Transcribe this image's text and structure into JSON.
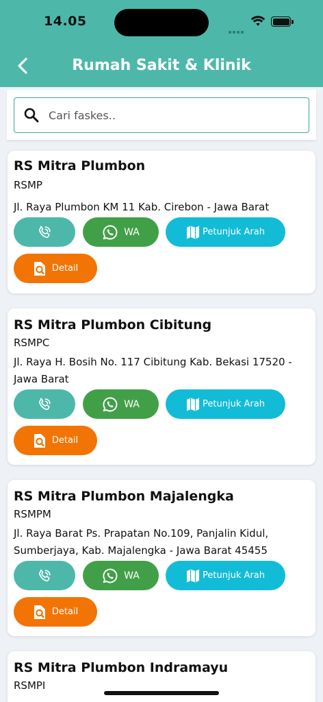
{
  "status_bar": {
    "time": "14.05"
  },
  "header": {
    "title": "Rumah Sakit & Klinik"
  },
  "search": {
    "placeholder": "Cari faskes.."
  },
  "facilities": [
    {
      "name": "RS Mitra Plumbon",
      "code": "RSMP",
      "address": "Jl. Raya Plumbon KM 11 Kab. Cirebon - Jawa Barat"
    },
    {
      "name": "RS Mitra Plumbon Cibitung",
      "code": "RSMPC",
      "address": "Jl. Raya H. Bosih No. 117 Cibitung Kab. Bekasi 17520 - Jawa Barat"
    },
    {
      "name": "RS Mitra Plumbon Majalengka",
      "code": "RSMPM",
      "address": "Jl. Raya Barat Ps. Prapatan No.109, Panjalin Kidul, Sumberjaya, Kab. Majalengka - Jawa Barat 45455"
    },
    {
      "name": "RS Mitra Plumbon Indramayu",
      "code": "RSMPI"
    }
  ],
  "actions": {
    "wa_label": "WA",
    "directions_label": "Petunjuk Arah",
    "detail_label": "Detail"
  },
  "colors": {
    "header": "#4db8aa",
    "call": "#4db8aa",
    "whatsapp": "#41a047",
    "directions": "#13bcd6",
    "detail": "#f27405"
  },
  "icons": {
    "back": "chevron-left-icon",
    "search": "search-icon",
    "call": "phone-call-icon",
    "whatsapp": "whatsapp-icon",
    "map": "map-icon",
    "detail": "search-document-icon"
  }
}
